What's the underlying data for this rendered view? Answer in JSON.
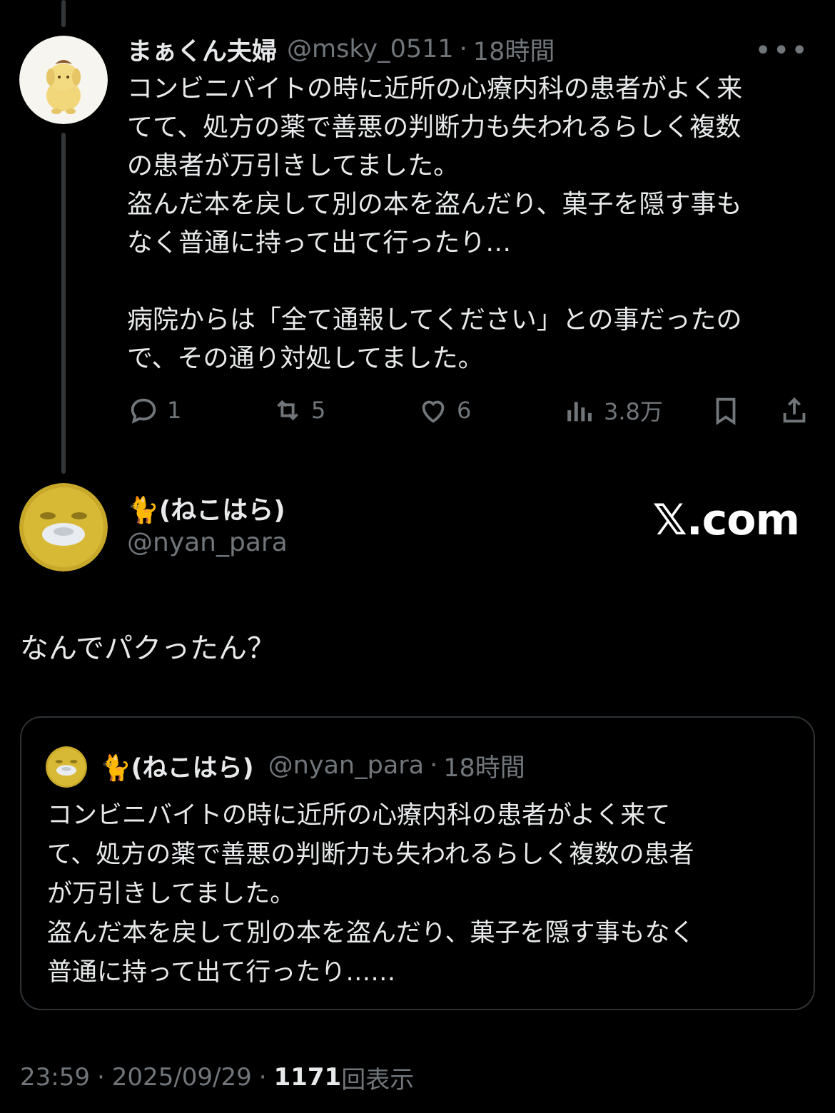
{
  "parent_tweet": {
    "display_name": "まぁくん夫婦",
    "handle": "@msky_0511",
    "separator": "·",
    "time": "18時間",
    "more_label": "•••",
    "text": "コンビニバイトの時に近所の心療内科の患者がよく来\nてて、処方の薬で善悪の判断力も失われるらしく複数\nの患者が万引きしてました。\n盗んだ本を戻して別の本を盗んだり、菓子を隠す事も\nなく普通に持って出て行ったり…\n\n病院からは「全て通報してください」との事だったの\nで、その通り対処してました。",
    "actions": {
      "replies": "1",
      "retweets": "5",
      "likes": "6",
      "views": "3.8万"
    },
    "avatar_icon": "pompompurin-avatar"
  },
  "reply_tweet": {
    "display_name": "🐈(ねこはら)",
    "handle": "@nyan_para",
    "text": "なんでパクったん？",
    "avatar_icon": "yellow-mask-avatar"
  },
  "watermark": "𝕏.com",
  "quoted_tweet": {
    "display_name": "🐈(ねこはら)",
    "handle": "@nyan_para",
    "separator": "·",
    "time": "18時間",
    "text": "コンビニバイトの時に近所の心療内科の患者がよく来て\nて、処方の薬で善悪の判断力も失われるらしく複数の患者\nが万引きしてました。\n盗んだ本を戻して別の本を盗んだり、菓子を隠す事もなく\n普通に持って出て行ったり……"
  },
  "footer": {
    "time": "23:59",
    "separator": "·",
    "date": "2025/09/29",
    "separator2": "·",
    "views_count": "1171",
    "views_label": "回表示"
  },
  "colors": {
    "background": "#000000",
    "text": "#e7e9ea",
    "muted": "#71767b",
    "border": "#2f3336"
  }
}
